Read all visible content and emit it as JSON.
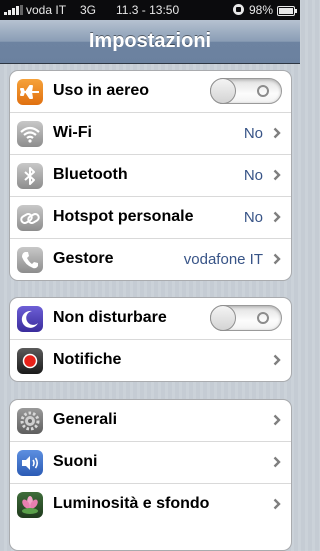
{
  "status_bar": {
    "carrier": "voda IT",
    "network": "3G",
    "time": "11.3 - 13:50",
    "battery": "98%"
  },
  "nav": {
    "title": "Impostazioni"
  },
  "groups": [
    {
      "rows": [
        {
          "label": "Uso in aereo",
          "icon": "airplane-icon",
          "toggle": "off"
        },
        {
          "label": "Wi-Fi",
          "value": "No",
          "icon": "wifi-icon"
        },
        {
          "label": "Bluetooth",
          "value": "No",
          "icon": "bluetooth-icon"
        },
        {
          "label": "Hotspot personale",
          "value": "No",
          "icon": "hotspot-icon"
        },
        {
          "label": "Gestore",
          "value": "vodafone IT",
          "icon": "phone-icon"
        }
      ]
    },
    {
      "rows": [
        {
          "label": "Non disturbare",
          "icon": "moon-icon",
          "toggle": "off"
        },
        {
          "label": "Notifiche",
          "icon": "notifications-icon"
        }
      ]
    },
    {
      "rows": [
        {
          "label": "Generali",
          "icon": "gear-icon"
        },
        {
          "label": "Suoni",
          "icon": "speaker-icon"
        },
        {
          "label": "Luminosità e sfondo",
          "icon": "flower-icon"
        }
      ]
    }
  ]
}
